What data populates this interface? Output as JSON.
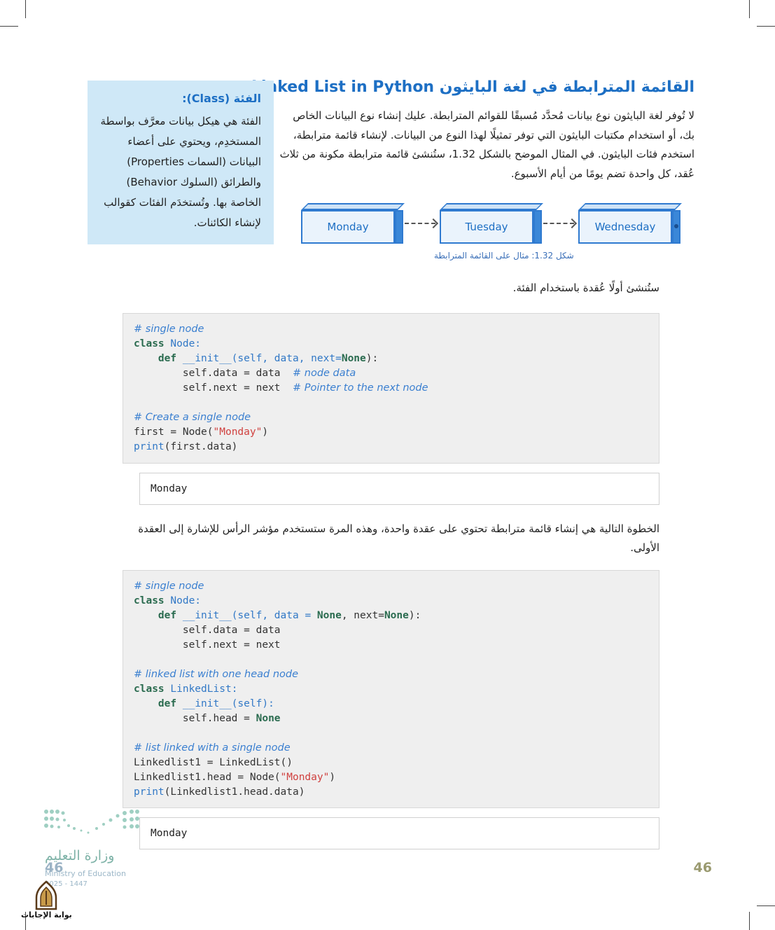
{
  "title": {
    "arabic": "القائمة المترابطة في لغة البايثون",
    "english": "Linked List in Python"
  },
  "intro_paragraph": "لا تُوفر لغة البايثون نوع بيانات مُحدَّد مُسبقًا للقوائم المترابطة. عليك إنشاء نوع البيانات الخاص بك، أو استخدام مكتبات البايثون التي توفر تمثيلًا لهذا النوع من البيانات. لإنشاء قائمة مترابطة، استخدم فئات البايثون. في المثال الموضح بالشكل 1.32، ستُنشئ قائمة مترابطة مكونة من ثلاث عُقد، كل واحدة تضم يومًا من أيام الأسبوع.",
  "sidebox": {
    "title": "الفئة (Class):",
    "body": "الفئة هي هيكل بيانات معرَّف بواسطة المستخدِم، ويحتوي على أعضاء البيانات (السمات Properties) والطرائق (السلوك Behavior) الخاصة بها. وتُستخدَم الفئات كقوالب لإنشاء الكائنات."
  },
  "figure": {
    "nodes": [
      "Monday",
      "Tuesday",
      "Wednesday"
    ],
    "caption": "شكل 1.32: مثال على القائمة المترابطة"
  },
  "step1_text": "ستُنشئ أولًا عُقدة باستخدام الفئة.",
  "code1": {
    "comment1": "# single node",
    "line_class": "Node:",
    "kw_class": "class",
    "kw_def": "def",
    "init_sig": "__init__(self, data, next=",
    "none": "None",
    "init_end": "):",
    "line_data": "self.data = data",
    "comment_data": "# node data",
    "line_next": "self.next = next",
    "comment_next": "# Pointer to the next node",
    "comment2": "# Create a single node",
    "first_pre": "first = Node(",
    "str_monday": "\"Monday\"",
    "first_post": ")",
    "print_fn": "print",
    "print_arg": "(first.data)"
  },
  "output1": "Monday",
  "step2_text": "الخطوة التالية هي إنشاء قائمة مترابطة تحتوي على عقدة واحدة، وهذه المرة ستستخدم مؤشر الرأس للإشارة إلى العقدة الأولى.",
  "code2": {
    "comment1": "# single node",
    "kw_class": "class",
    "class_node": "Node:",
    "kw_def": "def",
    "init_a": "__init__(self, data = ",
    "none": "None",
    "init_b": ", next=",
    "init_end": "):",
    "line_data": "self.data = data",
    "line_next": "self.next = next",
    "comment2": "# linked list with one head node",
    "class_ll": "LinkedList:",
    "init_self": "__init__(self):",
    "head_pre": "self.head = ",
    "comment3": "# list linked with a single node",
    "ll_line1": "Linkedlist1 = LinkedList()",
    "ll_line2_pre": "Linkedlist1.head = Node(",
    "str_monday": "\"Monday\"",
    "ll_line2_post": ")",
    "print_fn": "print",
    "print_arg": "(Linkedlist1.head.data)"
  },
  "output2": "Monday",
  "page_number": "46",
  "ministry": {
    "arabic": "وزارة التعليم",
    "english": "Ministry of Education",
    "year": "2025 - 1447"
  },
  "logo_text": "بوابة الإجابات"
}
